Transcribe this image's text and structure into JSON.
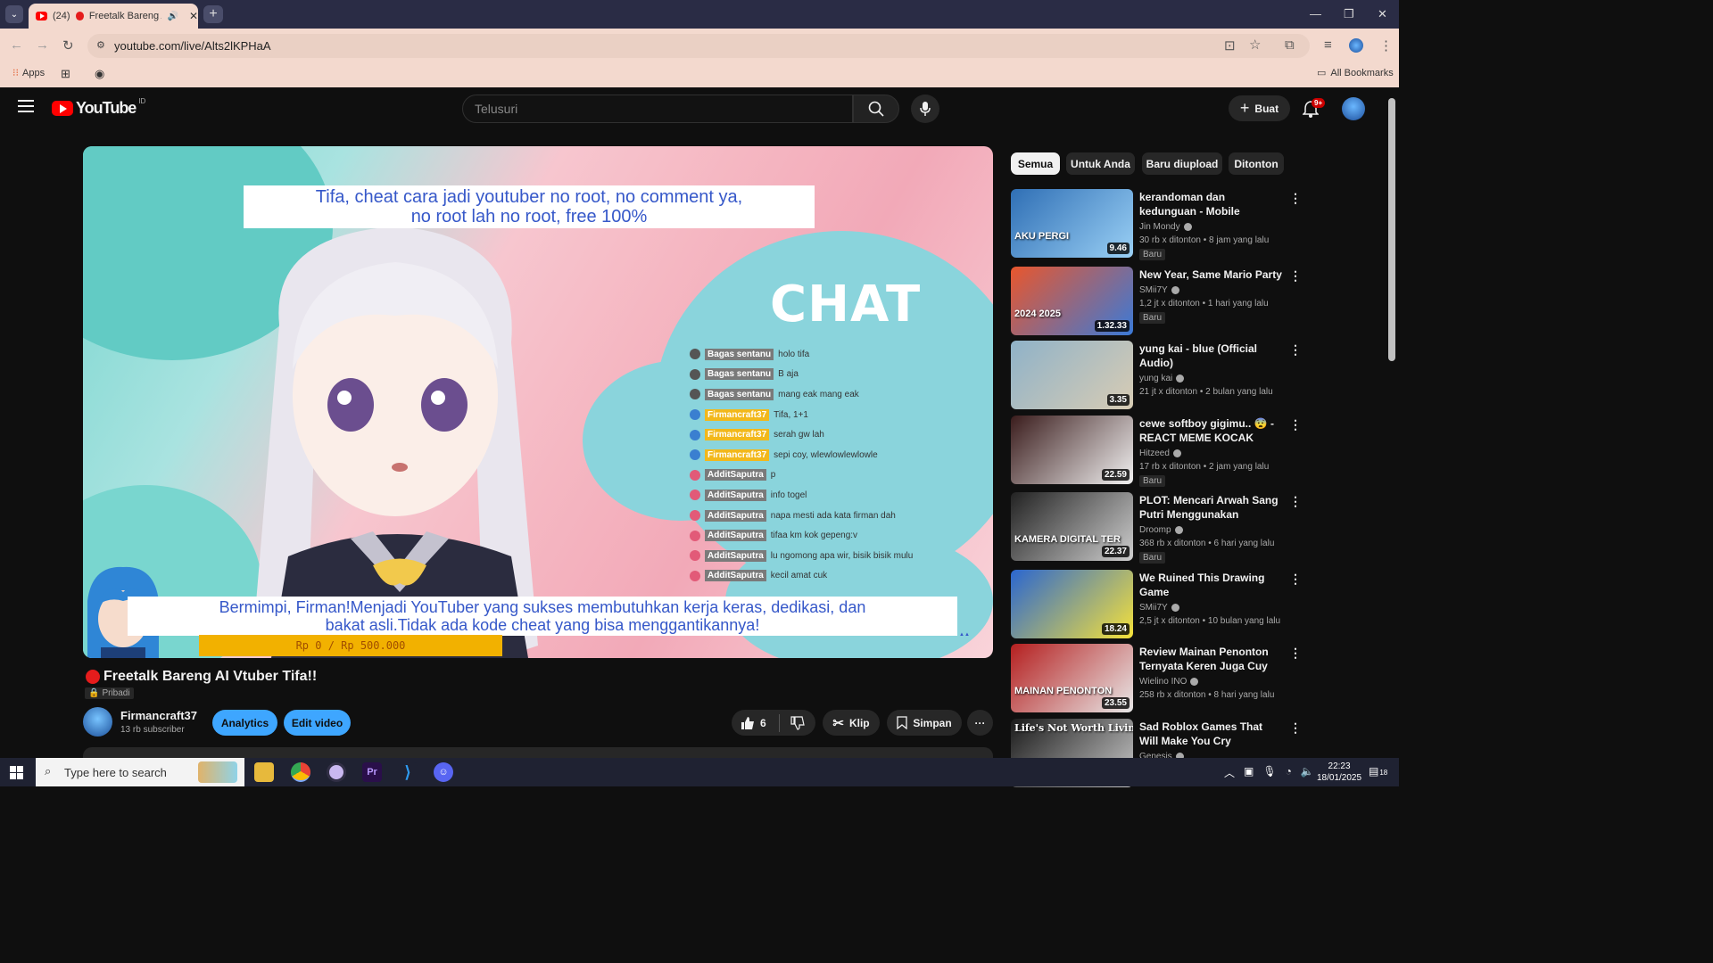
{
  "browser": {
    "tab": {
      "count_prefix": "(24)",
      "title": "Freetalk Bareng AI V"
    },
    "url": "youtube.com/live/Alts2lKPHaA",
    "bookmarks": {
      "apps": "Apps",
      "all": "All Bookmarks"
    }
  },
  "youtube": {
    "logo": "YouTube",
    "region": "ID",
    "search_placeholder": "Telusuri",
    "create_label": "Buat",
    "notif_badge": "9+"
  },
  "video": {
    "top_caption_line1": "Tifa, cheat cara jadi youtuber no root, no comment ya,",
    "top_caption_line2": "no root lah no root, free 100%",
    "chat_title": "CHAT",
    "chat": [
      {
        "name": "Bagas sentanu",
        "msg": "holo tifa",
        "style": "gray"
      },
      {
        "name": "Bagas sentanu",
        "msg": "B aja",
        "style": "gray"
      },
      {
        "name": "Bagas sentanu",
        "msg": "mang eak mang eak",
        "style": "gray"
      },
      {
        "name": "Firmancraft37",
        "msg": "Tifa, 1+1",
        "style": "gold"
      },
      {
        "name": "Firmancraft37",
        "msg": "serah gw lah",
        "style": "gold"
      },
      {
        "name": "Firmancraft37",
        "msg": "sepi coy, wlewlowlewlowle",
        "style": "gold"
      },
      {
        "name": "AdditSaputra",
        "msg": "p",
        "style": "gray"
      },
      {
        "name": "AdditSaputra",
        "msg": "info togel",
        "style": "gray"
      },
      {
        "name": "AdditSaputra",
        "msg": "napa mesti ada kata firman dah",
        "style": "gray"
      },
      {
        "name": "AdditSaputra",
        "msg": "tifaa km kok gepeng:v",
        "style": "gray"
      },
      {
        "name": "AdditSaputra",
        "msg": "lu ngomong apa wir, bisik bisik mulu",
        "style": "gray"
      },
      {
        "name": "AdditSaputra",
        "msg": "kecil amat cuk",
        "style": "gray"
      }
    ],
    "bottom_caption_line1": "Bermimpi, Firman!Menjadi YouTuber yang sukses membutuhkan kerja keras, dedikasi, dan",
    "bottom_caption_line2": "bakat asli.Tidak ada kode cheat yang bisa menggantikannya!",
    "donation_bar": "Rp 0 / Rp 500.000",
    "donation_progress": 0,
    "title": "Freetalk Bareng AI Vtuber Tifa!!",
    "privacy": "Pribadi",
    "channel": "Firmancraft37",
    "subscribers": "13 rb subscriber",
    "analytics_label": "Analytics",
    "edit_label": "Edit video",
    "likes": "6",
    "clip_label": "Klip",
    "save_label": "Simpan"
  },
  "chips": [
    "Semua",
    "Untuk Anda",
    "Baru diupload",
    "Ditonton"
  ],
  "recommendations": [
    {
      "title": "kerandoman dan kedunguan - Mobile Legends Indonesia",
      "channel": "Jin Mondy",
      "meta": "30 rb x ditonton • 8 jam yang lalu",
      "badge": "Baru",
      "duration": "9.46",
      "thumb_text": "AKU PERGI",
      "c1": "#2f6fb5",
      "c2": "#9ad0f5"
    },
    {
      "title": "New Year, Same Mario Party",
      "channel": "SMii7Y",
      "meta": "1,2 jt x ditonton • 1 hari yang lalu",
      "badge": "Baru",
      "duration": "1.32.33",
      "thumb_text": "2024  2025",
      "c1": "#e9562c",
      "c2": "#3a7ad8"
    },
    {
      "title": "yung kai - blue (Official Audio)",
      "channel": "yung kai",
      "meta": "21 jt x ditonton • 2 bulan yang lalu",
      "badge": "",
      "duration": "3.35",
      "thumb_text": "",
      "c1": "#8fb2c8",
      "c2": "#d8ccb4"
    },
    {
      "title": "cewe softboy gigimu.. 😨 - REACT MEME KOCAK",
      "channel": "Hitzeed",
      "meta": "17 rb x ditonton • 2 jam yang lalu",
      "badge": "Baru",
      "duration": "22.59",
      "thumb_text": "",
      "c1": "#3a1c1c",
      "c2": "#f2f2f2"
    },
    {
      "title": "PLOT: Mencari Arwah Sang Putri Menggunakan Kamera...",
      "channel": "Droomp",
      "meta": "368 rb x ditonton • 6 hari yang lalu",
      "badge": "Baru",
      "duration": "22.37",
      "thumb_text": "KAMERA DIGITAL TER",
      "c1": "#222222",
      "c2": "#cfcfcf"
    },
    {
      "title": "We Ruined This Drawing Game",
      "channel": "SMii7Y",
      "meta": "2,5 jt x ditonton • 10 bulan yang lalu",
      "badge": "",
      "duration": "18.24",
      "thumb_text": "",
      "c1": "#2a66d0",
      "c2": "#f6e23a"
    },
    {
      "title": "Review Mainan Penonton Ternyata Keren Juga Cuy 😎",
      "channel": "Wielino INO",
      "meta": "258 rb x ditonton • 8 hari yang lalu",
      "badge": "",
      "duration": "23.55",
      "thumb_text": "MAINAN PENONTON",
      "c1": "#b51f1f",
      "c2": "#e8e8e8"
    },
    {
      "title": "Sad Roblox Games That Will Make You Cry",
      "channel": "Genesis",
      "meta": "",
      "badge": "",
      "duration": "",
      "thumb_text": "Life's Not Worth Living",
      "c1": "#1a1a1a",
      "c2": "#c9c9c9"
    }
  ],
  "taskbar": {
    "search_placeholder": "Type here to search",
    "time": "22:23",
    "date": "18/01/2025",
    "notif_count": "18"
  }
}
